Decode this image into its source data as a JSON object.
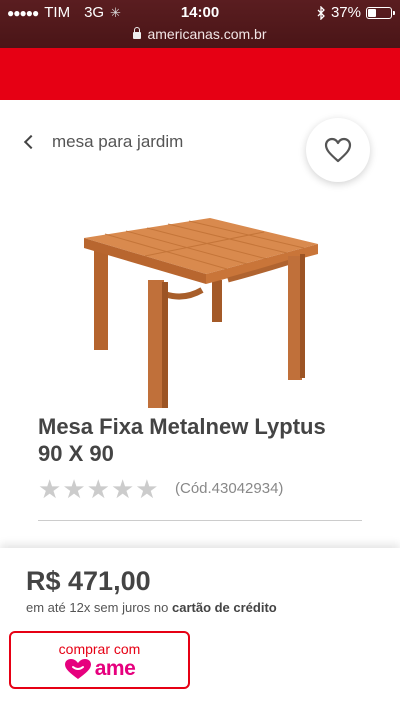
{
  "status_bar": {
    "signal_dots": "●●●●●",
    "carrier": "TIM",
    "network": "3G",
    "time": "14:00",
    "battery_percent_label": "37%",
    "battery_level": 0.37
  },
  "browser": {
    "url": "americanas.com.br"
  },
  "colors": {
    "brand_red": "#e60014",
    "ame_pink": "#e6007e",
    "status_bar_bg": "#531a1d"
  },
  "breadcrumb": {
    "back_label": "mesa para jardim"
  },
  "product": {
    "title": "Mesa Fixa Metalnew Lyptus 90 X 90",
    "rating_stars_filled": 0,
    "rating_stars_total": 5,
    "code": "(Cód.43042934)"
  },
  "pricing": {
    "price": "R$ 471,00",
    "installments_prefix": "em até 12x sem juros no",
    "installments_bold": "cartão de crédito"
  },
  "ame_button": {
    "top_label": "comprar com",
    "brand_label": "ame"
  },
  "icons": {
    "back": "chevron-left-icon",
    "favorite": "heart-outline-icon",
    "ame": "ame-heart-icon"
  }
}
